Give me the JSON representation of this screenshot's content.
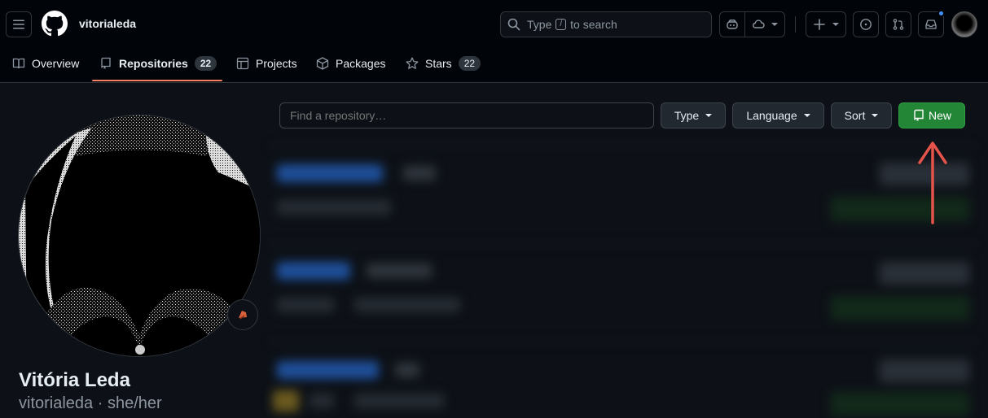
{
  "header": {
    "username": "vitorialeda",
    "search": {
      "prefix": "Type",
      "key": "/",
      "suffix": "to search"
    }
  },
  "tabs": [
    {
      "label": "Overview",
      "icon": "book-icon"
    },
    {
      "label": "Repositories",
      "icon": "repo-icon",
      "count": "22",
      "active": true
    },
    {
      "label": "Projects",
      "icon": "table-icon"
    },
    {
      "label": "Packages",
      "icon": "package-icon"
    },
    {
      "label": "Stars",
      "icon": "star-icon",
      "count": "22"
    }
  ],
  "profile": {
    "full_name": "Vitória Leda",
    "login": "vitorialeda",
    "pronouns": "she/her",
    "separator": "·"
  },
  "filters": {
    "find_placeholder": "Find a repository…",
    "type_label": "Type",
    "language_label": "Language",
    "sort_label": "Sort",
    "new_label": "New"
  },
  "colors": {
    "accent_green": "#238636",
    "tab_underline": "#f78166",
    "annotation_arrow": "#e5534b",
    "notification_dot": "#4493f8"
  }
}
